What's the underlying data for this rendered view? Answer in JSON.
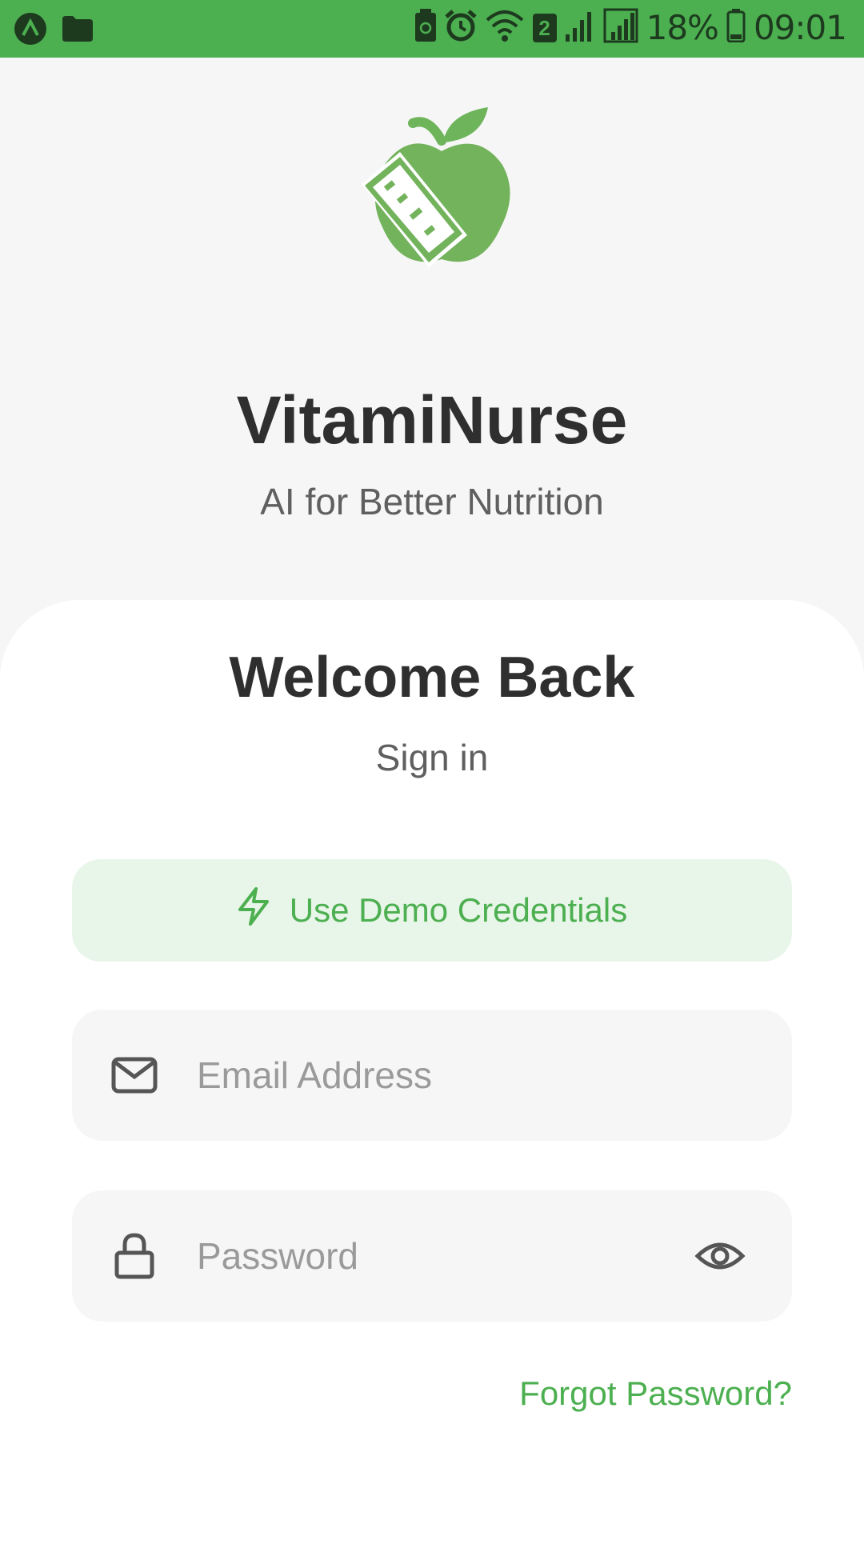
{
  "status_bar": {
    "battery_percent": "18%",
    "time": "09:01",
    "sim_badge": "2",
    "icons": [
      "app-a-icon",
      "folder-icon",
      "battery-saver-icon",
      "alarm-icon",
      "wifi-icon",
      "sim-2-icon",
      "signal-icon",
      "signal-icon",
      "battery-icon"
    ]
  },
  "header": {
    "app_name": "VitamiNurse",
    "tagline": "AI for Better Nutrition",
    "logo_icon": "apple-measuring-tape-logo"
  },
  "login": {
    "title": "Welcome Back",
    "subtitle": "Sign in",
    "demo_button_label": "Use Demo Credentials",
    "demo_button_icon": "lightning-bolt-icon",
    "email_placeholder": "Email Address",
    "email_value": "",
    "password_placeholder": "Password",
    "password_value": "",
    "forgot_password_label": "Forgot Password?"
  },
  "colors": {
    "brand_green": "#4caf50",
    "demo_button_bg": "#e8f5e9",
    "text_dark": "#2f2f2f",
    "text_muted": "#5f5f5f",
    "field_bg": "#f6f6f6"
  }
}
